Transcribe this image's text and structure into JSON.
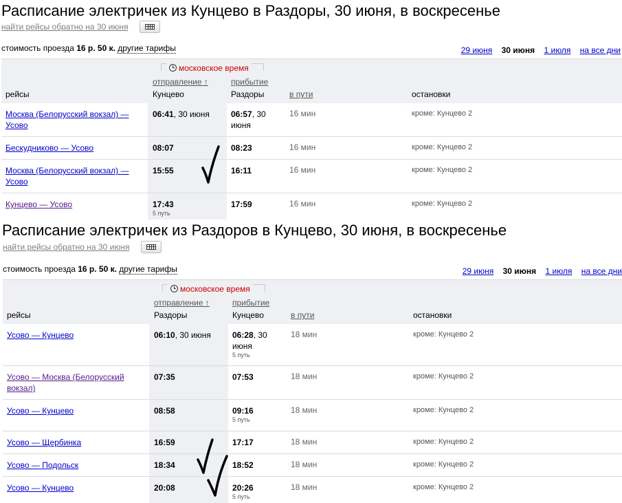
{
  "sections": [
    {
      "title": "Расписание электричек из Кунцево в Раздоры, 30 июня, в воскресенье",
      "backlink": "найти рейсы обратно на 30 июня",
      "price_prefix": "стоимость проезда ",
      "price": "16 р. 50 к.",
      "tariffs": "другие тарифы",
      "days": {
        "prev": "29 июня",
        "current": "30 июня",
        "next": "1 июля",
        "all": "на все дни"
      },
      "header": {
        "moscow_time": "московское время",
        "departure": "отправление ↑",
        "arrival": "прибытие",
        "trips": "рейсы",
        "dep_station": "Кунцево",
        "arr_station": "Раздоры",
        "en_route": "в пути",
        "stops": "остановки"
      },
      "rows": [
        {
          "route": "Москва (Белорусский вокзал) — Усово",
          "dep": "06:41",
          "dep_date": ", 30 июня",
          "dep_platform": "",
          "arr": "06:57",
          "arr_date": ", 30 июня",
          "arr_platform": "",
          "duration": "16 мин",
          "stops": "кроме: Кунцево 2"
        },
        {
          "route": "Бескудниково — Усово",
          "dep": "08:07",
          "dep_date": "",
          "dep_platform": "",
          "arr": "08:23",
          "arr_date": "",
          "arr_platform": "",
          "duration": "16 мин",
          "stops": "кроме: Кунцево 2"
        },
        {
          "route": "Москва (Белорусский вокзал) — Усово",
          "dep": "15:55",
          "dep_date": "",
          "dep_platform": "",
          "arr": "16:11",
          "arr_date": "",
          "arr_platform": "",
          "duration": "16 мин",
          "stops": "кроме: Кунцево 2"
        },
        {
          "route": "Кунцево — Усово",
          "dep": "17:43",
          "dep_date": "",
          "dep_platform": "5 путь",
          "arr": "17:59",
          "arr_date": "",
          "arr_platform": "",
          "duration": "16 мин",
          "stops": "кроме: Кунцево 2"
        }
      ]
    },
    {
      "title": "Расписание электричек из Раздоров в Кунцево, 30 июня, в воскресенье",
      "backlink": "найти рейсы обратно на 30 июня",
      "price_prefix": "стоимость проезда ",
      "price": "16 р. 50 к.",
      "tariffs": "другие тарифы",
      "days": {
        "prev": "29 июня",
        "current": "30 июня",
        "next": "1 июля",
        "all": "на все дни"
      },
      "header": {
        "moscow_time": "московское время",
        "departure": "отправление ↑",
        "arrival": "прибытие",
        "trips": "рейсы",
        "dep_station": "Раздоры",
        "arr_station": "Кунцево",
        "en_route": "в пути",
        "stops": "остановки"
      },
      "rows": [
        {
          "route": "Усово — Кунцево",
          "dep": "06:10",
          "dep_date": ", 30 июня",
          "dep_platform": "",
          "arr": "06:28",
          "arr_date": ", 30 июня",
          "arr_platform": "5 путь",
          "duration": "18 мин",
          "stops": "кроме: Кунцево 2"
        },
        {
          "route": "Усово — Москва (Белорусский вокзал)",
          "dep": "07:35",
          "dep_date": "",
          "dep_platform": "",
          "arr": "07:53",
          "arr_date": "",
          "arr_platform": "",
          "duration": "18 мин",
          "stops": "кроме: Кунцево 2"
        },
        {
          "route": "Усово — Кунцево",
          "dep": "08:58",
          "dep_date": "",
          "dep_platform": "",
          "arr": "09:16",
          "arr_date": "",
          "arr_platform": "5 путь",
          "duration": "18 мин",
          "stops": "кроме: Кунцево 2"
        },
        {
          "route": "Усово — Щербинка",
          "dep": "16:59",
          "dep_date": "",
          "dep_platform": "",
          "arr": "17:17",
          "arr_date": "",
          "arr_platform": "",
          "duration": "18 мин",
          "stops": "кроме: Кунцево 2"
        },
        {
          "route": "Усово — Подольск",
          "dep": "18:34",
          "dep_date": "",
          "dep_platform": "",
          "arr": "18:52",
          "arr_date": "",
          "arr_platform": "",
          "duration": "18 мин",
          "stops": "кроме: Кунцево 2"
        },
        {
          "route": "Усово — Кунцево",
          "dep": "20:08",
          "dep_date": "",
          "dep_platform": "",
          "arr": "20:26",
          "arr_date": "",
          "arr_platform": "5 путь",
          "duration": "18 мин",
          "stops": "кроме: Кунцево 2"
        }
      ]
    }
  ],
  "colors": {
    "link": "#0000cc",
    "visited": "#551a8b",
    "moscow_time": "#cc0000",
    "header_bg": "#eef0f3"
  }
}
